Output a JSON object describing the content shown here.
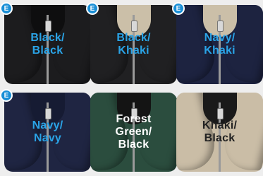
{
  "tiles": [
    {
      "label": "Black/\nBlack",
      "badge": "E",
      "body": "#1c1c1e",
      "lining": "#0e0e0f",
      "text_color": "#2aa3e6"
    },
    {
      "label": "Black/\nKhaki",
      "badge": "E",
      "body": "#202022",
      "lining": "#cbbfa8",
      "text_color": "#2aa3e6"
    },
    {
      "label": "Navy/\nKhaki",
      "badge": "E",
      "body": "#1d2340",
      "lining": "#cbbfa8",
      "text_color": "#2aa3e6"
    },
    {
      "label": "Navy/\nNavy",
      "badge": "E",
      "body": "#1f2542",
      "lining": "#161b33",
      "text_color": "#2aa3e6"
    },
    {
      "label": "Forest\nGreen/\nBlack",
      "badge": "",
      "body": "#2b4d3e",
      "lining": "#141414",
      "text_color": "#ffffff"
    },
    {
      "label": "Khaki/\nBlack",
      "badge": "",
      "body": "#cabda6",
      "lining": "#1a1a1a",
      "text_color": "#222222"
    }
  ]
}
